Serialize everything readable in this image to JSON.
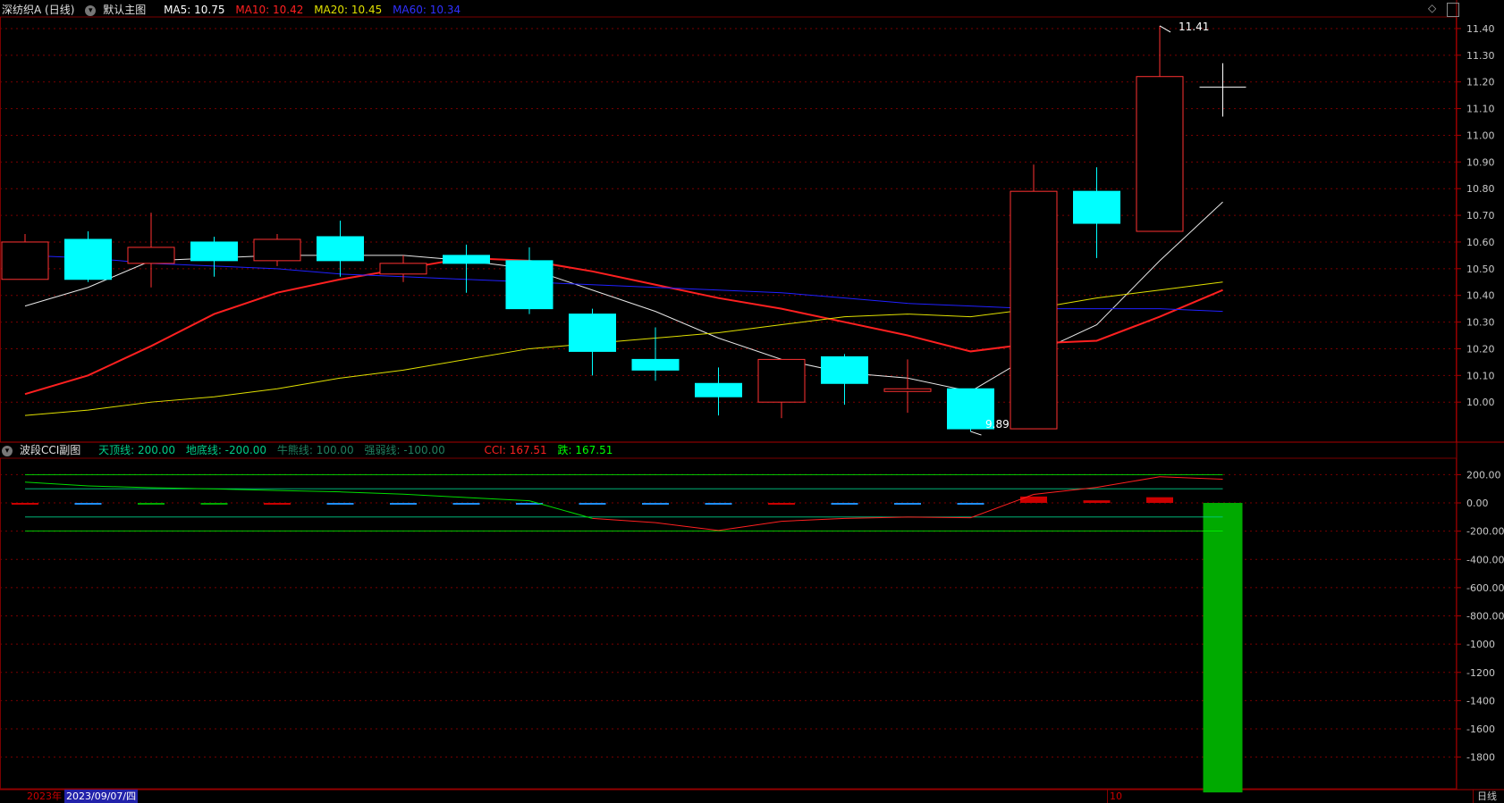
{
  "header": {
    "stock_name": "深纺织A (日线)",
    "chart_label": "默认主图",
    "ma5": "MA5: 10.75",
    "ma10": "MA10: 10.42",
    "ma20": "MA20: 10.45",
    "ma60": "MA60: 10.34",
    "colors": {
      "ma5": "#ffffff",
      "ma10": "#ff2020",
      "ma20": "#e0e000",
      "ma60": "#2020ff"
    }
  },
  "sub_header": {
    "indicator_name": "波段CCI副图",
    "top_line": "天顶线: 200.00",
    "bottom_line": "地底线: -200.00",
    "bull_line": "牛熊线: 100.00",
    "weak_line": "强弱线: -100.00",
    "cci": "CCI: 167.51",
    "fall": "跌: 167.51"
  },
  "bottom_bar": {
    "year": "2023年",
    "date_cursor": "2023/09/07/四",
    "month": "10",
    "period": "日线"
  },
  "annotations": {
    "high_label": "11.41",
    "low_label": "9.89"
  },
  "chart_data": [
    {
      "type": "candlestick",
      "yticks": [
        "11.40",
        "11.30",
        "11.20",
        "11.10",
        "11.00",
        "10.90",
        "10.80",
        "10.70",
        "10.60",
        "10.50",
        "10.40",
        "10.30",
        "10.20",
        "10.10",
        "10.00"
      ],
      "ylim": [
        9.85,
        11.44
      ],
      "candles": [
        {
          "o": 10.46,
          "c": 10.6,
          "h": 10.63,
          "l": 10.46
        },
        {
          "o": 10.61,
          "c": 10.46,
          "h": 10.64,
          "l": 10.45
        },
        {
          "o": 10.52,
          "c": 10.58,
          "h": 10.71,
          "l": 10.43
        },
        {
          "o": 10.6,
          "c": 10.53,
          "h": 10.62,
          "l": 10.47
        },
        {
          "o": 10.53,
          "c": 10.61,
          "h": 10.63,
          "l": 10.51
        },
        {
          "o": 10.62,
          "c": 10.53,
          "h": 10.68,
          "l": 10.47
        },
        {
          "o": 10.48,
          "c": 10.52,
          "h": 10.55,
          "l": 10.45
        },
        {
          "o": 10.55,
          "c": 10.52,
          "h": 10.59,
          "l": 10.41
        },
        {
          "o": 10.53,
          "c": 10.35,
          "h": 10.58,
          "l": 10.33
        },
        {
          "o": 10.33,
          "c": 10.19,
          "h": 10.35,
          "l": 10.1
        },
        {
          "o": 10.16,
          "c": 10.12,
          "h": 10.28,
          "l": 10.08
        },
        {
          "o": 10.07,
          "c": 10.02,
          "h": 10.13,
          "l": 9.95
        },
        {
          "o": 10.0,
          "c": 10.16,
          "h": 10.16,
          "l": 9.94
        },
        {
          "o": 10.17,
          "c": 10.07,
          "h": 10.18,
          "l": 9.99
        },
        {
          "o": 10.04,
          "c": 10.05,
          "h": 10.16,
          "l": 9.96
        },
        {
          "o": 10.05,
          "c": 9.9,
          "h": 10.05,
          "l": 9.89
        },
        {
          "o": 9.9,
          "c": 10.79,
          "h": 10.89,
          "l": 9.9
        },
        {
          "o": 10.79,
          "c": 10.67,
          "h": 10.88,
          "l": 10.54
        },
        {
          "o": 10.64,
          "c": 11.22,
          "h": 11.41,
          "l": 10.64
        },
        {
          "o": 11.18,
          "c": 11.18,
          "h": 11.27,
          "l": 11.07
        }
      ],
      "series": [
        {
          "name": "MA5",
          "values": [
            10.36,
            10.43,
            10.53,
            10.54,
            10.55,
            10.55,
            10.55,
            10.53,
            10.5,
            10.42,
            10.34,
            10.24,
            10.16,
            10.11,
            10.09,
            10.04,
            10.18,
            10.29,
            10.53,
            10.75
          ]
        },
        {
          "name": "MA10",
          "values": [
            10.03,
            10.1,
            10.21,
            10.33,
            10.41,
            10.46,
            10.5,
            10.54,
            10.53,
            10.49,
            10.44,
            10.39,
            10.35,
            10.3,
            10.25,
            10.19,
            10.22,
            10.23,
            10.32,
            10.42
          ]
        },
        {
          "name": "MA20",
          "values": [
            9.95,
            9.97,
            10.0,
            10.02,
            10.05,
            10.09,
            10.12,
            10.16,
            10.2,
            10.22,
            10.24,
            10.26,
            10.29,
            10.32,
            10.33,
            10.32,
            10.35,
            10.39,
            10.42,
            10.45
          ]
        },
        {
          "name": "MA60",
          "values": [
            10.55,
            10.54,
            10.52,
            10.51,
            10.5,
            10.48,
            10.47,
            10.46,
            10.45,
            10.44,
            10.43,
            10.42,
            10.41,
            10.39,
            10.37,
            10.36,
            10.35,
            10.35,
            10.35,
            10.34
          ]
        }
      ]
    },
    {
      "type": "bar",
      "yticks": [
        "200.00",
        "0.00",
        "-200.00",
        "-400.00",
        "-600.00",
        "-800.00",
        "-1000",
        "-1200",
        "-1400",
        "-1600",
        "-1800"
      ],
      "ylim": [
        -2030,
        310
      ],
      "reference_lines": [
        200,
        100,
        -100,
        -200
      ],
      "cci_line": [
        147,
        120,
        108,
        99,
        88,
        78,
        62,
        38,
        15,
        -110,
        -140,
        -195,
        -130,
        -110,
        -100,
        -105,
        60,
        110,
        185,
        167.51
      ],
      "bars": [
        {
          "value": -8,
          "color": "#cc0000"
        },
        {
          "value": -4,
          "color": "#2090ff"
        },
        {
          "value": -6,
          "color": "#00aa00"
        },
        {
          "value": -4,
          "color": "#00aa00"
        },
        {
          "value": -8,
          "color": "#cc0000"
        },
        {
          "value": -4,
          "color": "#2090ff"
        },
        {
          "value": -4,
          "color": "#2090ff"
        },
        {
          "value": -4,
          "color": "#2090ff"
        },
        {
          "value": -4,
          "color": "#2090ff"
        },
        {
          "value": -4,
          "color": "#2090ff"
        },
        {
          "value": -4,
          "color": "#2090ff"
        },
        {
          "value": -4,
          "color": "#2090ff"
        },
        {
          "value": -8,
          "color": "#cc0000"
        },
        {
          "value": -4,
          "color": "#2090ff"
        },
        {
          "value": -4,
          "color": "#2090ff"
        },
        {
          "value": -4,
          "color": "#2090ff"
        },
        {
          "value": 45,
          "color": "#cc0000"
        },
        {
          "value": 18,
          "color": "#cc0000"
        },
        {
          "value": 40,
          "color": "#cc0000"
        },
        {
          "value": -2050,
          "color": "#00aa00"
        }
      ]
    }
  ],
  "colors": {
    "up": "#ff3232",
    "down": "#00ffff",
    "grid": "#7a0000",
    "axis_text": "#c8c8c8",
    "cci": "#00dd00",
    "cci_pos": "#ff2020",
    "ref_line": "#00cc88",
    "bright_ref": "#00ff00"
  }
}
